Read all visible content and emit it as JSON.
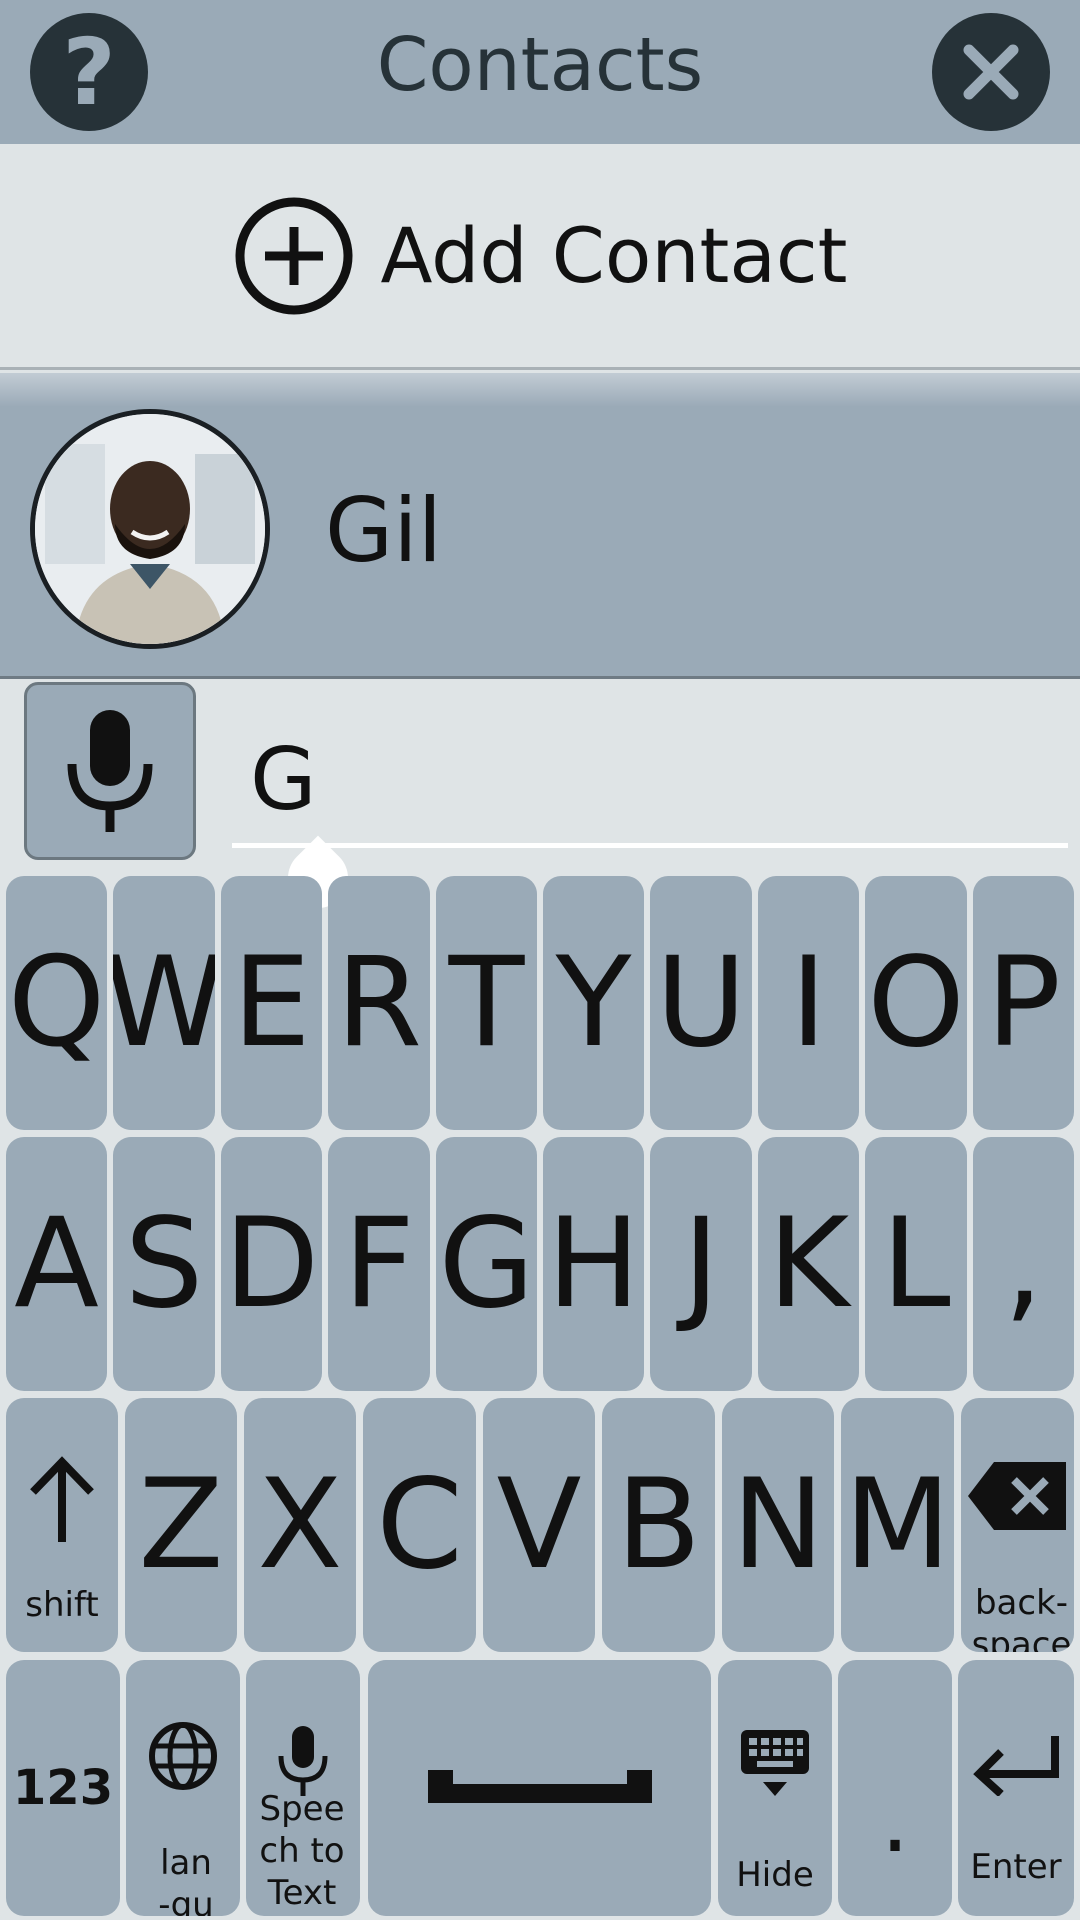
{
  "header": {
    "help_label": "?",
    "title": "Contacts"
  },
  "add_contact": {
    "label": "Add Contact"
  },
  "contacts": [
    {
      "name": "Gil"
    }
  ],
  "input": {
    "value": "G"
  },
  "keyboard": {
    "row1": [
      "Q",
      "W",
      "E",
      "R",
      "T",
      "Y",
      "U",
      "I",
      "O",
      "P"
    ],
    "row2": [
      "A",
      "S",
      "D",
      "F",
      "G",
      "H",
      "J",
      "K",
      "L",
      ","
    ],
    "row3": [
      "Z",
      "X",
      "C",
      "V",
      "B",
      "N",
      "M"
    ],
    "shift_label": "shift",
    "backspace_label": "back-space",
    "numbers_label": "123",
    "language_label": "lan-guage",
    "speech_label": "Speech to Text",
    "hide_label": "Hide",
    "period_label": ".",
    "enter_label": "Enter"
  },
  "icons": {
    "help": "question-mark-icon",
    "close": "close-icon",
    "add": "plus-circle-icon",
    "mic": "microphone-icon",
    "shift": "arrow-up-icon",
    "backspace": "backspace-icon",
    "language": "globe-icon",
    "speech": "microphone-icon",
    "space": "space-bar-icon",
    "hide": "keyboard-hide-icon",
    "enter": "enter-arrow-icon"
  },
  "colors": {
    "accent": "#9aaab7",
    "background": "#dfe4e6",
    "dark": "#263238"
  }
}
